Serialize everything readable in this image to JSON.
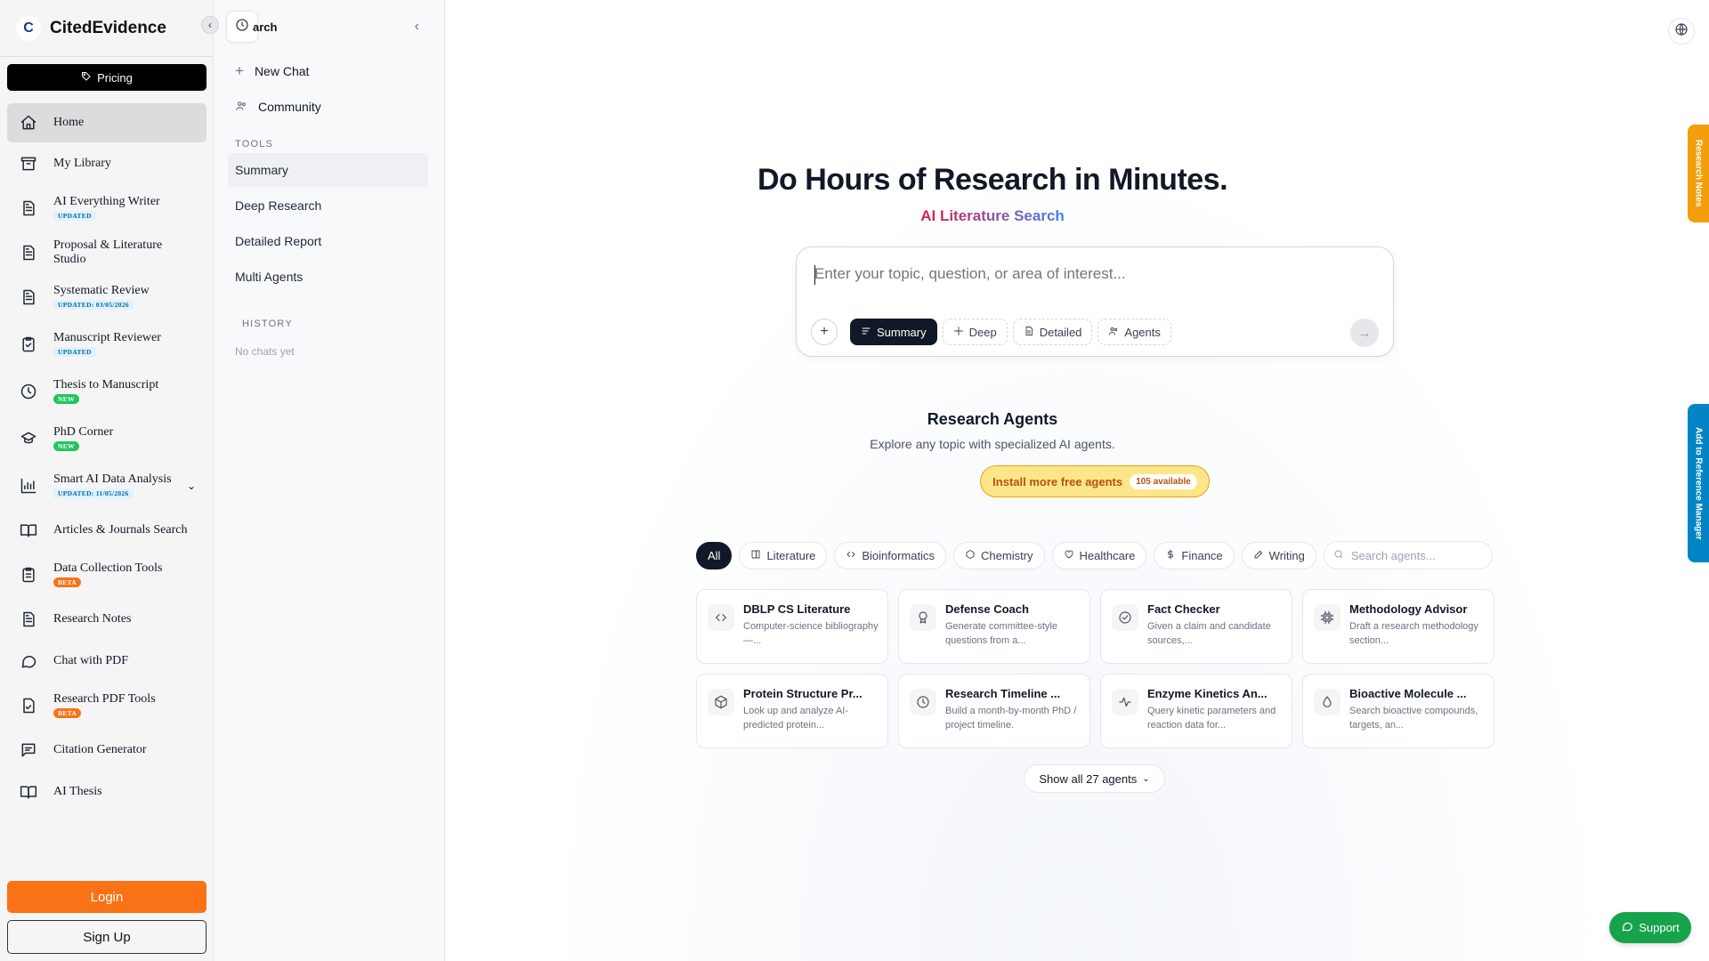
{
  "brand": {
    "name": "CitedEvidence",
    "logo_letter": "C"
  },
  "sidebar": {
    "pricing_label": "Pricing",
    "items": [
      {
        "label": "Home",
        "icon": "home-icon",
        "badge": null,
        "active": true
      },
      {
        "label": "My Library",
        "icon": "archive-icon",
        "badge": null
      },
      {
        "label": "AI Everything Writer",
        "icon": "document-icon",
        "badge": "UPDATED",
        "badge_type": "updated"
      },
      {
        "label": "Proposal & Literature Studio",
        "icon": "document-icon",
        "badge": null
      },
      {
        "label": "Systematic Review",
        "icon": "document-icon",
        "badge": "UPDATED: 03/05/2026",
        "badge_type": "updated"
      },
      {
        "label": "Manuscript Reviewer",
        "icon": "clipboard-check-icon",
        "badge": "UPDATED",
        "badge_type": "updated"
      },
      {
        "label": "Thesis to Manuscript",
        "icon": "clock-icon",
        "badge": "NEW",
        "badge_type": "new"
      },
      {
        "label": "PhD Corner",
        "icon": "graduation-cap-icon",
        "badge": "NEW",
        "badge_type": "new"
      },
      {
        "label": "Smart AI Data Analysis",
        "icon": "bar-chart-icon",
        "badge": "UPDATED: 11/05/2026",
        "badge_type": "updated",
        "expandable": true
      },
      {
        "label": "Articles & Journals Search",
        "icon": "book-open-icon",
        "badge": null
      },
      {
        "label": "Data Collection Tools",
        "icon": "clipboard-list-icon",
        "badge": "BETA",
        "badge_type": "beta"
      },
      {
        "label": "Research Notes",
        "icon": "document-icon",
        "badge": null
      },
      {
        "label": "Chat with PDF",
        "icon": "chat-icon",
        "badge": null
      },
      {
        "label": "Research PDF Tools",
        "icon": "file-check-icon",
        "badge": "BETA",
        "badge_type": "beta"
      },
      {
        "label": "Citation Generator",
        "icon": "message-quote-icon",
        "badge": null
      },
      {
        "label": "AI Thesis",
        "icon": "book-open-icon",
        "badge": null
      }
    ],
    "login_label": "Login",
    "signup_label": "Sign Up"
  },
  "panel": {
    "title": "arch",
    "new_chat_label": "New Chat",
    "community_label": "Community",
    "tools_heading": "TOOLS",
    "tools": [
      "Summary",
      "Deep Research",
      "Detailed Report",
      "Multi Agents"
    ],
    "active_tool": "Summary",
    "history_heading": "HISTORY",
    "history_empty": "No chats yet"
  },
  "hero": {
    "title": "Do Hours of Research in Minutes.",
    "subtitle": "AI Literature Search"
  },
  "search": {
    "placeholder": "Enter your topic, question, or area of interest...",
    "modes": [
      {
        "label": "Summary",
        "icon": "lines-icon",
        "active": true
      },
      {
        "label": "Deep",
        "icon": "sparkle-icon"
      },
      {
        "label": "Detailed",
        "icon": "file-icon"
      },
      {
        "label": "Agents",
        "icon": "users-icon"
      }
    ]
  },
  "agents": {
    "title": "Research Agents",
    "subtitle": "Explore any topic with specialized AI agents.",
    "install_label": "Install more free agents",
    "install_count": "105 available",
    "filters": [
      {
        "label": "All",
        "icon": null,
        "active": true
      },
      {
        "label": "Literature",
        "icon": "book-icon"
      },
      {
        "label": "Bioinformatics",
        "icon": "code-icon"
      },
      {
        "label": "Chemistry",
        "icon": "hexagon-icon"
      },
      {
        "label": "Healthcare",
        "icon": "heart-icon"
      },
      {
        "label": "Finance",
        "icon": "dollar-icon"
      },
      {
        "label": "Writing",
        "icon": "edit-icon"
      }
    ],
    "search_placeholder": "Search agents...",
    "cards": [
      {
        "title": "DBLP CS Literature",
        "desc": "Computer-science bibliography —...",
        "icon": "code-icon"
      },
      {
        "title": "Defense Coach",
        "desc": "Generate committee-style questions from a...",
        "icon": "award-icon"
      },
      {
        "title": "Fact Checker",
        "desc": "Given a claim and candidate sources,...",
        "icon": "check-circle-icon"
      },
      {
        "title": "Methodology Advisor",
        "desc": "Draft a research methodology section...",
        "icon": "cpu-icon"
      },
      {
        "title": "Protein Structure Pr...",
        "desc": "Look up and analyze AI-predicted protein...",
        "icon": "box-icon"
      },
      {
        "title": "Research Timeline ...",
        "desc": "Build a month-by-month PhD / project timeline.",
        "icon": "clock-icon"
      },
      {
        "title": "Enzyme Kinetics An...",
        "desc": "Query kinetic parameters and reaction data for...",
        "icon": "activity-icon"
      },
      {
        "title": "Bioactive Molecule ...",
        "desc": "Search bioactive compounds, targets, an...",
        "icon": "drop-icon"
      }
    ],
    "show_all_label": "Show all 27 agents"
  },
  "side_tabs": {
    "notes": "Research Notes",
    "reference": "Add to Reference Manager"
  },
  "support_label": "Support"
}
